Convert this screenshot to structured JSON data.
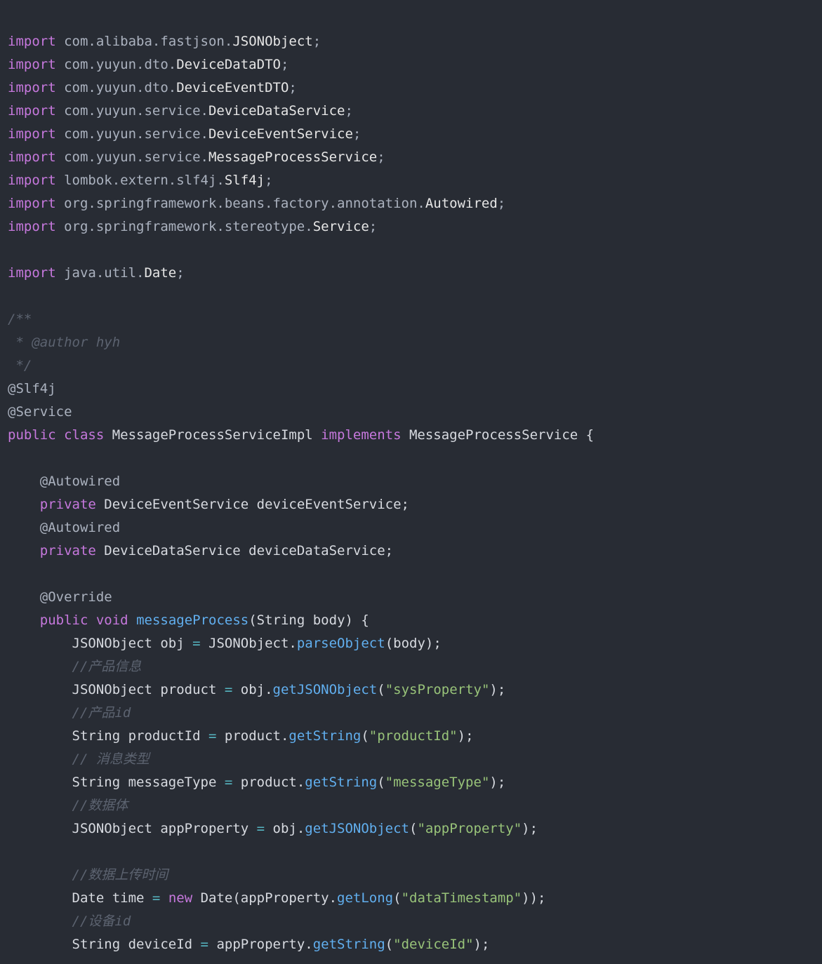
{
  "code": {
    "lines": [
      {
        "tokens": [
          {
            "t": "import",
            "c": "kw"
          },
          {
            "t": " com.alibaba.fastjson.",
            "c": "pkg"
          },
          {
            "t": "JSONObject",
            "c": "cls"
          },
          {
            "t": ";",
            "c": "punc"
          }
        ]
      },
      {
        "tokens": [
          {
            "t": "import",
            "c": "kw"
          },
          {
            "t": " com.yuyun.dto.",
            "c": "pkg"
          },
          {
            "t": "DeviceDataDTO",
            "c": "cls"
          },
          {
            "t": ";",
            "c": "punc"
          }
        ]
      },
      {
        "tokens": [
          {
            "t": "import",
            "c": "kw"
          },
          {
            "t": " com.yuyun.dto.",
            "c": "pkg"
          },
          {
            "t": "DeviceEventDTO",
            "c": "cls"
          },
          {
            "t": ";",
            "c": "punc"
          }
        ]
      },
      {
        "tokens": [
          {
            "t": "import",
            "c": "kw"
          },
          {
            "t": " com.yuyun.service.",
            "c": "pkg"
          },
          {
            "t": "DeviceDataService",
            "c": "cls"
          },
          {
            "t": ";",
            "c": "punc"
          }
        ]
      },
      {
        "tokens": [
          {
            "t": "import",
            "c": "kw"
          },
          {
            "t": " com.yuyun.service.",
            "c": "pkg"
          },
          {
            "t": "DeviceEventService",
            "c": "cls"
          },
          {
            "t": ";",
            "c": "punc"
          }
        ]
      },
      {
        "tokens": [
          {
            "t": "import",
            "c": "kw"
          },
          {
            "t": " com.yuyun.service.",
            "c": "pkg"
          },
          {
            "t": "MessageProcessService",
            "c": "cls"
          },
          {
            "t": ";",
            "c": "punc"
          }
        ]
      },
      {
        "tokens": [
          {
            "t": "import",
            "c": "kw"
          },
          {
            "t": " lombok.extern.slf4j.",
            "c": "pkg"
          },
          {
            "t": "Slf4j",
            "c": "cls"
          },
          {
            "t": ";",
            "c": "punc"
          }
        ]
      },
      {
        "tokens": [
          {
            "t": "import",
            "c": "kw"
          },
          {
            "t": " org.springframework.beans.factory.annotation.",
            "c": "pkg"
          },
          {
            "t": "Autowired",
            "c": "cls"
          },
          {
            "t": ";",
            "c": "punc"
          }
        ]
      },
      {
        "tokens": [
          {
            "t": "import",
            "c": "kw"
          },
          {
            "t": " org.springframework.stereotype.",
            "c": "pkg"
          },
          {
            "t": "Service",
            "c": "cls"
          },
          {
            "t": ";",
            "c": "punc"
          }
        ]
      },
      {
        "tokens": []
      },
      {
        "tokens": [
          {
            "t": "import",
            "c": "kw"
          },
          {
            "t": " java.util.",
            "c": "pkg"
          },
          {
            "t": "Date",
            "c": "cls"
          },
          {
            "t": ";",
            "c": "punc"
          }
        ]
      },
      {
        "tokens": []
      },
      {
        "tokens": [
          {
            "t": "/**",
            "c": "cmt"
          }
        ]
      },
      {
        "tokens": [
          {
            "t": " * @author hyh",
            "c": "cmt"
          }
        ]
      },
      {
        "tokens": [
          {
            "t": " */",
            "c": "cmt"
          }
        ]
      },
      {
        "tokens": [
          {
            "t": "@Slf4j",
            "c": "ann"
          }
        ]
      },
      {
        "tokens": [
          {
            "t": "@Service",
            "c": "ann"
          }
        ]
      },
      {
        "tokens": [
          {
            "t": "public",
            "c": "kw"
          },
          {
            "t": " ",
            "c": "punc"
          },
          {
            "t": "class",
            "c": "kw"
          },
          {
            "t": " MessageProcessServiceImpl ",
            "c": "ident"
          },
          {
            "t": "implements",
            "c": "kw"
          },
          {
            "t": " MessageProcessService {",
            "c": "ident"
          }
        ]
      },
      {
        "tokens": []
      },
      {
        "tokens": [
          {
            "t": "    @Autowired",
            "c": "ann"
          }
        ]
      },
      {
        "tokens": [
          {
            "t": "    ",
            "c": "punc"
          },
          {
            "t": "private",
            "c": "kw"
          },
          {
            "t": " DeviceEventService deviceEventService;",
            "c": "ident"
          }
        ]
      },
      {
        "tokens": [
          {
            "t": "    @Autowired",
            "c": "ann"
          }
        ]
      },
      {
        "tokens": [
          {
            "t": "    ",
            "c": "punc"
          },
          {
            "t": "private",
            "c": "kw"
          },
          {
            "t": " DeviceDataService deviceDataService;",
            "c": "ident"
          }
        ]
      },
      {
        "tokens": []
      },
      {
        "tokens": [
          {
            "t": "    @Override",
            "c": "ann"
          }
        ]
      },
      {
        "tokens": [
          {
            "t": "    ",
            "c": "punc"
          },
          {
            "t": "public",
            "c": "kw"
          },
          {
            "t": " ",
            "c": "punc"
          },
          {
            "t": "void",
            "c": "kw"
          },
          {
            "t": " ",
            "c": "punc"
          },
          {
            "t": "messageProcess",
            "c": "fn"
          },
          {
            "t": "(String body) {",
            "c": "ident"
          }
        ]
      },
      {
        "tokens": [
          {
            "t": "        JSONObject obj ",
            "c": "ident"
          },
          {
            "t": "=",
            "c": "op"
          },
          {
            "t": " JSONObject.",
            "c": "ident"
          },
          {
            "t": "parseObject",
            "c": "fn"
          },
          {
            "t": "(body);",
            "c": "ident"
          }
        ]
      },
      {
        "tokens": [
          {
            "t": "        //产品信息",
            "c": "cmt"
          }
        ]
      },
      {
        "tokens": [
          {
            "t": "        JSONObject product ",
            "c": "ident"
          },
          {
            "t": "=",
            "c": "op"
          },
          {
            "t": " obj.",
            "c": "ident"
          },
          {
            "t": "getJSONObject",
            "c": "fn"
          },
          {
            "t": "(",
            "c": "ident"
          },
          {
            "t": "\"sysProperty\"",
            "c": "str"
          },
          {
            "t": ");",
            "c": "ident"
          }
        ]
      },
      {
        "tokens": [
          {
            "t": "        //产品id",
            "c": "cmt"
          }
        ]
      },
      {
        "tokens": [
          {
            "t": "        String productId ",
            "c": "ident"
          },
          {
            "t": "=",
            "c": "op"
          },
          {
            "t": " product.",
            "c": "ident"
          },
          {
            "t": "getString",
            "c": "fn"
          },
          {
            "t": "(",
            "c": "ident"
          },
          {
            "t": "\"productId\"",
            "c": "str"
          },
          {
            "t": ");",
            "c": "ident"
          }
        ]
      },
      {
        "tokens": [
          {
            "t": "        // 消息类型",
            "c": "cmt"
          }
        ]
      },
      {
        "tokens": [
          {
            "t": "        String messageType ",
            "c": "ident"
          },
          {
            "t": "=",
            "c": "op"
          },
          {
            "t": " product.",
            "c": "ident"
          },
          {
            "t": "getString",
            "c": "fn"
          },
          {
            "t": "(",
            "c": "ident"
          },
          {
            "t": "\"messageType\"",
            "c": "str"
          },
          {
            "t": ");",
            "c": "ident"
          }
        ]
      },
      {
        "tokens": [
          {
            "t": "        //数据体",
            "c": "cmt"
          }
        ]
      },
      {
        "tokens": [
          {
            "t": "        JSONObject appProperty ",
            "c": "ident"
          },
          {
            "t": "=",
            "c": "op"
          },
          {
            "t": " obj.",
            "c": "ident"
          },
          {
            "t": "getJSONObject",
            "c": "fn"
          },
          {
            "t": "(",
            "c": "ident"
          },
          {
            "t": "\"appProperty\"",
            "c": "str"
          },
          {
            "t": ");",
            "c": "ident"
          }
        ]
      },
      {
        "tokens": []
      },
      {
        "tokens": [
          {
            "t": "        //数据上传时间",
            "c": "cmt"
          }
        ]
      },
      {
        "tokens": [
          {
            "t": "        Date time ",
            "c": "ident"
          },
          {
            "t": "=",
            "c": "op"
          },
          {
            "t": " ",
            "c": "punc"
          },
          {
            "t": "new",
            "c": "kw"
          },
          {
            "t": " Date(appProperty.",
            "c": "ident"
          },
          {
            "t": "getLong",
            "c": "fn"
          },
          {
            "t": "(",
            "c": "ident"
          },
          {
            "t": "\"dataTimestamp\"",
            "c": "str"
          },
          {
            "t": "));",
            "c": "ident"
          }
        ]
      },
      {
        "tokens": [
          {
            "t": "        //设备id",
            "c": "cmt"
          }
        ]
      },
      {
        "tokens": [
          {
            "t": "        String deviceId ",
            "c": "ident"
          },
          {
            "t": "=",
            "c": "op"
          },
          {
            "t": " appProperty.",
            "c": "ident"
          },
          {
            "t": "getString",
            "c": "fn"
          },
          {
            "t": "(",
            "c": "ident"
          },
          {
            "t": "\"deviceId\"",
            "c": "str"
          },
          {
            "t": ");",
            "c": "ident"
          }
        ]
      }
    ]
  }
}
